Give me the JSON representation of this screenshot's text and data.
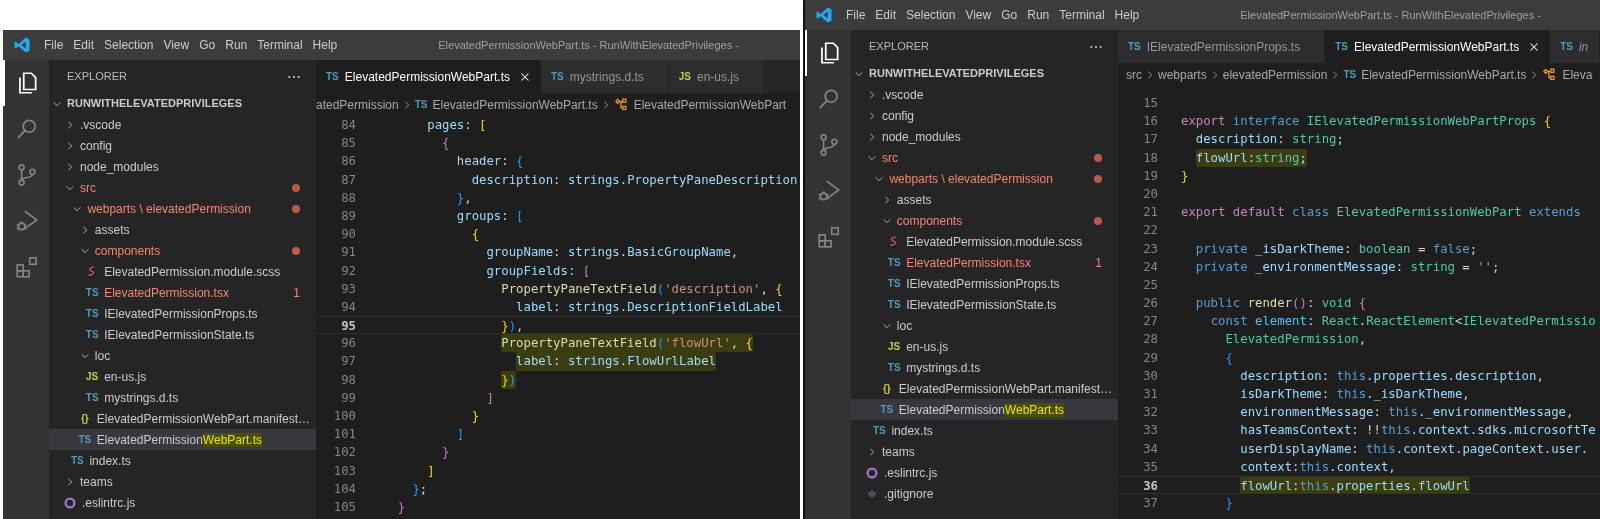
{
  "windows": [
    {
      "title": "ElevatedPermissionWebPart.ts - RunWithElevatedPrivileges -",
      "menu": [
        "File",
        "Edit",
        "Selection",
        "View",
        "Go",
        "Run",
        "Terminal",
        "Help"
      ],
      "activity_bar": [
        {
          "kind": "explorer",
          "selected": true
        },
        {
          "kind": "search",
          "selected": false
        },
        {
          "kind": "source-control",
          "selected": false
        },
        {
          "kind": "run-debug",
          "selected": false
        },
        {
          "kind": "extensions",
          "selected": false
        }
      ],
      "explorer": {
        "header": "EXPLORER",
        "tree": [
          {
            "label": "RUNWITHELEVATEDPRIVILEGES",
            "kind": "root",
            "expanded": true,
            "selected": false,
            "modified": false,
            "children": [
              {
                "label": ".vscode",
                "kind": "folder",
                "expanded": false,
                "selected": false,
                "modified": false
              },
              {
                "label": "config",
                "kind": "folder",
                "expanded": false,
                "selected": false,
                "modified": false
              },
              {
                "label": "node_modules",
                "kind": "folder",
                "expanded": false,
                "selected": false,
                "modified": false
              },
              {
                "label": "src",
                "kind": "folder",
                "expanded": true,
                "selected": false,
                "modified": true,
                "children": [
                  {
                    "label": "webparts \\ elevatedPermission",
                    "kind": "folder",
                    "expanded": true,
                    "selected": false,
                    "modified": true,
                    "children": [
                      {
                        "label": "assets",
                        "kind": "folder",
                        "expanded": false,
                        "selected": false,
                        "modified": false
                      },
                      {
                        "label": "components",
                        "kind": "folder",
                        "expanded": true,
                        "selected": false,
                        "modified": true,
                        "children": [
                          {
                            "label": "ElevatedPermission.module.scss",
                            "kind": "scss",
                            "selected": false,
                            "modified": false
                          },
                          {
                            "label": "ElevatedPermission.tsx",
                            "kind": "ts",
                            "icon": "TS",
                            "selected": false,
                            "modified": true,
                            "badge": "1"
                          },
                          {
                            "label": "IElevatedPermissionProps.ts",
                            "kind": "ts",
                            "icon": "TS",
                            "selected": false,
                            "modified": false
                          },
                          {
                            "label": "IElevatedPermissionState.ts",
                            "kind": "ts",
                            "icon": "TS",
                            "selected": false,
                            "modified": false
                          }
                        ]
                      },
                      {
                        "label": "loc",
                        "kind": "folder",
                        "expanded": true,
                        "selected": false,
                        "modified": false,
                        "children": [
                          {
                            "label": "en-us.js",
                            "kind": "js",
                            "icon": "JS",
                            "selected": false,
                            "modified": false
                          },
                          {
                            "label": "mystrings.d.ts",
                            "kind": "ts",
                            "icon": "TS",
                            "selected": false,
                            "modified": false
                          }
                        ]
                      },
                      {
                        "label": "ElevatedPermissionWebPart.manifest…",
                        "kind": "json",
                        "icon": "{}",
                        "selected": false,
                        "modified": false
                      },
                      {
                        "label_parts": [
                          {
                            "text": "ElevatedPermission",
                            "highlighted": false
                          },
                          {
                            "text": "WebPart.ts",
                            "highlighted": true
                          }
                        ],
                        "kind": "ts",
                        "icon": "TS",
                        "selected": true,
                        "modified": false
                      }
                    ]
                  },
                  {
                    "label": "index.ts",
                    "kind": "ts",
                    "icon": "TS",
                    "selected": false,
                    "modified": false
                  }
                ]
              },
              {
                "label": "teams",
                "kind": "folder",
                "expanded": false,
                "selected": false,
                "modified": false
              },
              {
                "label": ".eslintrc.js",
                "kind": "eslint",
                "selected": false,
                "modified": false
              }
            ]
          }
        ]
      },
      "tabs": [
        {
          "kind": "ts",
          "icon": "TS",
          "label": "ElevatedPermissionWebPart.ts",
          "selected": true,
          "preview": false
        },
        {
          "kind": "ts",
          "icon": "TS",
          "label": "mystrings.d.ts",
          "selected": false,
          "preview": false
        },
        {
          "kind": "js",
          "icon": "JS",
          "label": "en-us.js",
          "selected": false,
          "preview": false
        }
      ],
      "breadcrumb": [
        {
          "label": "atedPermission",
          "kind": "folder"
        },
        {
          "label": "ElevatedPermissionWebPart.ts",
          "kind": "file",
          "icon": "TS"
        },
        {
          "label": "ElevatedPermissionWebPart",
          "kind": "class"
        }
      ],
      "code": {
        "lines": [
          {
            "number": "84",
            "current": false,
            "highlighted": false,
            "tokens": [
              {
                "text": "        pages",
                "kind": "variable"
              },
              {
                "text": ": ",
                "kind": "punctuation"
              },
              {
                "text": "[",
                "kind": "bracket-1"
              }
            ]
          },
          {
            "number": "85",
            "current": false,
            "highlighted": false,
            "tokens": [
              {
                "text": "          {",
                "kind": "bracket-2"
              }
            ]
          },
          {
            "number": "86",
            "current": false,
            "highlighted": false,
            "tokens": [
              {
                "text": "            header",
                "kind": "variable"
              },
              {
                "text": ": ",
                "kind": "punctuation"
              },
              {
                "text": "{",
                "kind": "bracket-3"
              }
            ]
          },
          {
            "number": "87",
            "current": false,
            "highlighted": false,
            "tokens": [
              {
                "text": "              description",
                "kind": "variable"
              },
              {
                "text": ": ",
                "kind": "punctuation"
              },
              {
                "text": "strings",
                "kind": "variable"
              },
              {
                "text": ".",
                "kind": "punctuation"
              },
              {
                "text": "PropertyPaneDescription",
                "kind": "variable"
              }
            ]
          },
          {
            "number": "88",
            "current": false,
            "highlighted": false,
            "tokens": [
              {
                "text": "            }",
                "kind": "bracket-3"
              },
              {
                "text": ",",
                "kind": "punctuation"
              }
            ]
          },
          {
            "number": "89",
            "current": false,
            "highlighted": false,
            "tokens": [
              {
                "text": "            groups",
                "kind": "variable"
              },
              {
                "text": ": ",
                "kind": "punctuation"
              },
              {
                "text": "[",
                "kind": "bracket-3"
              }
            ]
          },
          {
            "number": "90",
            "current": false,
            "highlighted": false,
            "tokens": [
              {
                "text": "              {",
                "kind": "bracket-1"
              }
            ]
          },
          {
            "number": "91",
            "current": false,
            "highlighted": false,
            "tokens": [
              {
                "text": "                groupName",
                "kind": "variable"
              },
              {
                "text": ": ",
                "kind": "punctuation"
              },
              {
                "text": "strings",
                "kind": "variable"
              },
              {
                "text": ".",
                "kind": "punctuation"
              },
              {
                "text": "BasicGroupName",
                "kind": "variable"
              },
              {
                "text": ",",
                "kind": "punctuation"
              }
            ]
          },
          {
            "number": "92",
            "current": false,
            "highlighted": false,
            "tokens": [
              {
                "text": "                groupFields",
                "kind": "variable"
              },
              {
                "text": ": ",
                "kind": "punctuation"
              },
              {
                "text": "[",
                "kind": "bracket-2"
              }
            ]
          },
          {
            "number": "93",
            "current": false,
            "highlighted": false,
            "tokens": [
              {
                "text": "                  PropertyPaneTextField",
                "kind": "function"
              },
              {
                "text": "(",
                "kind": "bracket-3"
              },
              {
                "text": "'description'",
                "kind": "string"
              },
              {
                "text": ", ",
                "kind": "punctuation"
              },
              {
                "text": "{",
                "kind": "bracket-1"
              }
            ]
          },
          {
            "number": "94",
            "current": false,
            "highlighted": false,
            "tokens": [
              {
                "text": "                    label",
                "kind": "variable"
              },
              {
                "text": ": ",
                "kind": "punctuation"
              },
              {
                "text": "strings",
                "kind": "variable"
              },
              {
                "text": ".",
                "kind": "punctuation"
              },
              {
                "text": "DescriptionFieldLabel",
                "kind": "variable"
              }
            ]
          },
          {
            "number": "95",
            "current": true,
            "highlighted": false,
            "tokens": [
              {
                "text": "                  }",
                "kind": "bracket-1"
              },
              {
                "text": ")",
                "kind": "bracket-3"
              },
              {
                "text": ",",
                "kind": "punctuation"
              }
            ]
          },
          {
            "number": "96",
            "current": false,
            "highlighted": true,
            "tokens": [
              {
                "text": "                  PropertyPaneTextField",
                "kind": "function"
              },
              {
                "text": "(",
                "kind": "bracket-3"
              },
              {
                "text": "'flowUrl'",
                "kind": "string"
              },
              {
                "text": ", ",
                "kind": "punctuation"
              },
              {
                "text": "{",
                "kind": "bracket-1"
              }
            ]
          },
          {
            "number": "97",
            "current": false,
            "highlighted": true,
            "tokens": [
              {
                "text": "                    label",
                "kind": "variable"
              },
              {
                "text": ": ",
                "kind": "punctuation"
              },
              {
                "text": "strings",
                "kind": "variable"
              },
              {
                "text": ".",
                "kind": "punctuation"
              },
              {
                "text": "FlowUrlLabel",
                "kind": "variable"
              }
            ]
          },
          {
            "number": "98",
            "current": false,
            "highlighted": true,
            "tokens": [
              {
                "text": "                  }",
                "kind": "bracket-1"
              },
              {
                "text": ")",
                "kind": "bracket-3"
              }
            ]
          },
          {
            "number": "99",
            "current": false,
            "highlighted": false,
            "tokens": [
              {
                "text": "                ]",
                "kind": "bracket-2"
              }
            ]
          },
          {
            "number": "100",
            "current": false,
            "highlighted": false,
            "tokens": [
              {
                "text": "              }",
                "kind": "bracket-1"
              }
            ]
          },
          {
            "number": "101",
            "current": false,
            "highlighted": false,
            "tokens": [
              {
                "text": "            ]",
                "kind": "bracket-3"
              }
            ]
          },
          {
            "number": "102",
            "current": false,
            "highlighted": false,
            "tokens": [
              {
                "text": "          }",
                "kind": "bracket-2"
              }
            ]
          },
          {
            "number": "103",
            "current": false,
            "highlighted": false,
            "tokens": [
              {
                "text": "        ]",
                "kind": "bracket-1"
              }
            ]
          },
          {
            "number": "104",
            "current": false,
            "highlighted": false,
            "tokens": [
              {
                "text": "      }",
                "kind": "bracket-3"
              },
              {
                "text": ";",
                "kind": "punctuation"
              }
            ]
          },
          {
            "number": "105",
            "current": false,
            "highlighted": false,
            "tokens": [
              {
                "text": "    }",
                "kind": "bracket-2"
              }
            ]
          }
        ]
      }
    },
    {
      "title": "ElevatedPermissionWebPart.ts - RunWithElevatedPrivileges -",
      "menu": [
        "File",
        "Edit",
        "Selection",
        "View",
        "Go",
        "Run",
        "Terminal",
        "Help"
      ],
      "activity_bar": [
        {
          "kind": "explorer",
          "selected": true
        },
        {
          "kind": "search",
          "selected": false
        },
        {
          "kind": "source-control",
          "selected": false
        },
        {
          "kind": "run-debug",
          "selected": false
        },
        {
          "kind": "extensions",
          "selected": false
        }
      ],
      "explorer": {
        "header": "EXPLORER",
        "tree": [
          {
            "label": "RUNWITHELEVATEDPRIVILEGES",
            "kind": "root",
            "expanded": true,
            "selected": false,
            "modified": false,
            "children": [
              {
                "label": ".vscode",
                "kind": "folder",
                "expanded": false,
                "selected": false,
                "modified": false
              },
              {
                "label": "config",
                "kind": "folder",
                "expanded": false,
                "selected": false,
                "modified": false
              },
              {
                "label": "node_modules",
                "kind": "folder",
                "expanded": false,
                "selected": false,
                "modified": false
              },
              {
                "label": "src",
                "kind": "folder",
                "expanded": true,
                "selected": false,
                "modified": true,
                "children": [
                  {
                    "label": "webparts \\ elevatedPermission",
                    "kind": "folder",
                    "expanded": true,
                    "selected": false,
                    "modified": true,
                    "children": [
                      {
                        "label": "assets",
                        "kind": "folder",
                        "expanded": false,
                        "selected": false,
                        "modified": false
                      },
                      {
                        "label": "components",
                        "kind": "folder",
                        "expanded": true,
                        "selected": false,
                        "modified": true,
                        "children": [
                          {
                            "label": "ElevatedPermission.module.scss",
                            "kind": "scss",
                            "selected": false,
                            "modified": false
                          },
                          {
                            "label": "ElevatedPermission.tsx",
                            "kind": "ts",
                            "icon": "TS",
                            "selected": false,
                            "modified": true,
                            "badge": "1"
                          },
                          {
                            "label": "IElevatedPermissionProps.ts",
                            "kind": "ts",
                            "icon": "TS",
                            "selected": false,
                            "modified": false
                          },
                          {
                            "label": "IElevatedPermissionState.ts",
                            "kind": "ts",
                            "icon": "TS",
                            "selected": false,
                            "modified": false
                          }
                        ]
                      },
                      {
                        "label": "loc",
                        "kind": "folder",
                        "expanded": true,
                        "selected": false,
                        "modified": false,
                        "children": [
                          {
                            "label": "en-us.js",
                            "kind": "js",
                            "icon": "JS",
                            "selected": false,
                            "modified": false
                          },
                          {
                            "label": "mystrings.d.ts",
                            "kind": "ts",
                            "icon": "TS",
                            "selected": false,
                            "modified": false
                          }
                        ]
                      },
                      {
                        "label": "ElevatedPermissionWebPart.manifest…",
                        "kind": "json",
                        "icon": "{}",
                        "selected": false,
                        "modified": false
                      },
                      {
                        "label_parts": [
                          {
                            "text": "ElevatedPermission",
                            "highlighted": false
                          },
                          {
                            "text": "WebPart.ts",
                            "highlighted": true
                          }
                        ],
                        "kind": "ts",
                        "icon": "TS",
                        "selected": true,
                        "modified": false
                      }
                    ]
                  },
                  {
                    "label": "index.ts",
                    "kind": "ts",
                    "icon": "TS",
                    "selected": false,
                    "modified": false
                  }
                ]
              },
              {
                "label": "teams",
                "kind": "folder",
                "expanded": false,
                "selected": false,
                "modified": false
              },
              {
                "label": ".eslintrc.js",
                "kind": "eslint",
                "selected": false,
                "modified": false
              },
              {
                "label": ".gitignore",
                "kind": "git",
                "selected": false,
                "modified": false
              }
            ]
          }
        ]
      },
      "tabs": [
        {
          "kind": "ts",
          "icon": "TS",
          "label": "IElevatedPermissionProps.ts",
          "selected": false,
          "preview": false
        },
        {
          "kind": "ts",
          "icon": "TS",
          "label": "ElevatedPermissionWebPart.ts",
          "selected": true,
          "preview": false
        },
        {
          "kind": "ts",
          "icon": "TS",
          "label": "in",
          "selected": false,
          "preview": true
        }
      ],
      "breadcrumb": [
        {
          "label": "src",
          "kind": "folder"
        },
        {
          "label": "webparts",
          "kind": "folder"
        },
        {
          "label": "elevatedPermission",
          "kind": "folder"
        },
        {
          "label": "ElevatedPermissionWebPart.ts",
          "kind": "file",
          "icon": "TS"
        },
        {
          "label": "Eleva",
          "kind": "class"
        }
      ],
      "code": {
        "lines": [
          {
            "number": "15",
            "current": false
          },
          {
            "number": "16",
            "current": false,
            "highlighted": false,
            "tokens": [
              {
                "text": "export",
                "kind": "keyword-control"
              },
              {
                "text": " interface",
                "kind": "keyword"
              },
              {
                "text": " IElevatedPermissionWebPartProps",
                "kind": "type"
              },
              {
                "text": " {",
                "kind": "bracket-1"
              }
            ]
          },
          {
            "number": "17",
            "current": false,
            "highlighted": false,
            "tokens": [
              {
                "text": "  description",
                "kind": "variable"
              },
              {
                "text": ": ",
                "kind": "punctuation"
              },
              {
                "text": "string",
                "kind": "type"
              },
              {
                "text": ";",
                "kind": "punctuation"
              }
            ]
          },
          {
            "number": "18",
            "current": false,
            "highlighted": true,
            "tokens": [
              {
                "text": "  flowUrl",
                "kind": "variable"
              },
              {
                "text": ":",
                "kind": "punctuation"
              },
              {
                "text": "string",
                "kind": "type"
              },
              {
                "text": ";",
                "kind": "punctuation"
              }
            ]
          },
          {
            "number": "19",
            "current": false,
            "highlighted": false,
            "tokens": [
              {
                "text": "}",
                "kind": "bracket-1"
              }
            ]
          },
          {
            "number": "20",
            "current": false
          },
          {
            "number": "21",
            "current": false,
            "highlighted": false,
            "tokens": [
              {
                "text": "export default",
                "kind": "keyword-control"
              },
              {
                "text": " class",
                "kind": "keyword"
              },
              {
                "text": " ElevatedPermissionWebPart",
                "kind": "type"
              },
              {
                "text": " extends",
                "kind": "keyword"
              }
            ]
          },
          {
            "number": "22",
            "current": false
          },
          {
            "number": "23",
            "current": false,
            "highlighted": false,
            "tokens": [
              {
                "text": "  private",
                "kind": "keyword"
              },
              {
                "text": " _isDarkTheme",
                "kind": "variable"
              },
              {
                "text": ": ",
                "kind": "punctuation"
              },
              {
                "text": "boolean",
                "kind": "type"
              },
              {
                "text": " = ",
                "kind": "punctuation"
              },
              {
                "text": "false",
                "kind": "keyword"
              },
              {
                "text": ";",
                "kind": "punctuation"
              }
            ]
          },
          {
            "number": "24",
            "current": false,
            "highlighted": false,
            "tokens": [
              {
                "text": "  private",
                "kind": "keyword"
              },
              {
                "text": " _environmentMessage",
                "kind": "variable"
              },
              {
                "text": ": ",
                "kind": "punctuation"
              },
              {
                "text": "string",
                "kind": "type"
              },
              {
                "text": " = ",
                "kind": "punctuation"
              },
              {
                "text": "''",
                "kind": "string"
              },
              {
                "text": ";",
                "kind": "punctuation"
              }
            ]
          },
          {
            "number": "25",
            "current": false
          },
          {
            "number": "26",
            "current": false,
            "highlighted": false,
            "tokens": [
              {
                "text": "  public",
                "kind": "keyword"
              },
              {
                "text": " render",
                "kind": "function"
              },
              {
                "text": "()",
                "kind": "bracket-2"
              },
              {
                "text": ": ",
                "kind": "punctuation"
              },
              {
                "text": "void",
                "kind": "type"
              },
              {
                "text": " {",
                "kind": "bracket-2"
              }
            ]
          },
          {
            "number": "27",
            "current": false,
            "highlighted": false,
            "tokens": [
              {
                "text": "    const",
                "kind": "keyword"
              },
              {
                "text": " element",
                "kind": "constant"
              },
              {
                "text": ": ",
                "kind": "punctuation"
              },
              {
                "text": "React",
                "kind": "type"
              },
              {
                "text": ".",
                "kind": "punctuation"
              },
              {
                "text": "ReactElement",
                "kind": "type"
              },
              {
                "text": "<",
                "kind": "punctuation"
              },
              {
                "text": "IElevatedPermissio",
                "kind": "type"
              }
            ]
          },
          {
            "number": "28",
            "current": false,
            "highlighted": false,
            "tokens": [
              {
                "text": "      ElevatedPermission",
                "kind": "type"
              },
              {
                "text": ",",
                "kind": "punctuation"
              }
            ]
          },
          {
            "number": "29",
            "current": false,
            "highlighted": false,
            "tokens": [
              {
                "text": "      {",
                "kind": "bracket-3"
              }
            ]
          },
          {
            "number": "30",
            "current": false,
            "highlighted": false,
            "tokens": [
              {
                "text": "        description",
                "kind": "variable"
              },
              {
                "text": ": ",
                "kind": "punctuation"
              },
              {
                "text": "this",
                "kind": "keyword"
              },
              {
                "text": ".",
                "kind": "punctuation"
              },
              {
                "text": "properties",
                "kind": "variable"
              },
              {
                "text": ".",
                "kind": "punctuation"
              },
              {
                "text": "description",
                "kind": "variable"
              },
              {
                "text": ",",
                "kind": "punctuation"
              }
            ]
          },
          {
            "number": "31",
            "current": false,
            "highlighted": false,
            "tokens": [
              {
                "text": "        isDarkTheme",
                "kind": "variable"
              },
              {
                "text": ": ",
                "kind": "punctuation"
              },
              {
                "text": "this",
                "kind": "keyword"
              },
              {
                "text": ".",
                "kind": "punctuation"
              },
              {
                "text": "_isDarkTheme",
                "kind": "variable"
              },
              {
                "text": ",",
                "kind": "punctuation"
              }
            ]
          },
          {
            "number": "32",
            "current": false,
            "highlighted": false,
            "tokens": [
              {
                "text": "        environmentMessage",
                "kind": "variable"
              },
              {
                "text": ": ",
                "kind": "punctuation"
              },
              {
                "text": "this",
                "kind": "keyword"
              },
              {
                "text": ".",
                "kind": "punctuation"
              },
              {
                "text": "_environmentMessage",
                "kind": "variable"
              },
              {
                "text": ",",
                "kind": "punctuation"
              }
            ]
          },
          {
            "number": "33",
            "current": false,
            "highlighted": false,
            "tokens": [
              {
                "text": "        hasTeamsContext",
                "kind": "variable"
              },
              {
                "text": ": !!",
                "kind": "punctuation"
              },
              {
                "text": "this",
                "kind": "keyword"
              },
              {
                "text": ".",
                "kind": "punctuation"
              },
              {
                "text": "context",
                "kind": "variable"
              },
              {
                "text": ".",
                "kind": "punctuation"
              },
              {
                "text": "sdks",
                "kind": "variable"
              },
              {
                "text": ".",
                "kind": "punctuation"
              },
              {
                "text": "microsoftTe",
                "kind": "variable"
              }
            ]
          },
          {
            "number": "34",
            "current": false,
            "highlighted": false,
            "tokens": [
              {
                "text": "        userDisplayName",
                "kind": "variable"
              },
              {
                "text": ": ",
                "kind": "punctuation"
              },
              {
                "text": "this",
                "kind": "keyword"
              },
              {
                "text": ".",
                "kind": "punctuation"
              },
              {
                "text": "context",
                "kind": "variable"
              },
              {
                "text": ".",
                "kind": "punctuation"
              },
              {
                "text": "pageContext",
                "kind": "variable"
              },
              {
                "text": ".",
                "kind": "punctuation"
              },
              {
                "text": "user",
                "kind": "variable"
              },
              {
                "text": ".",
                "kind": "punctuation"
              }
            ]
          },
          {
            "number": "35",
            "current": false,
            "highlighted": false,
            "tokens": [
              {
                "text": "        context",
                "kind": "variable"
              },
              {
                "text": ":",
                "kind": "punctuation"
              },
              {
                "text": "this",
                "kind": "keyword"
              },
              {
                "text": ".",
                "kind": "punctuation"
              },
              {
                "text": "context",
                "kind": "variable"
              },
              {
                "text": ",",
                "kind": "punctuation"
              }
            ]
          },
          {
            "number": "36",
            "current": true,
            "highlighted": true,
            "tokens": [
              {
                "text": "        flowUrl",
                "kind": "variable"
              },
              {
                "text": ":",
                "kind": "punctuation"
              },
              {
                "text": "this",
                "kind": "keyword"
              },
              {
                "text": ".",
                "kind": "punctuation"
              },
              {
                "text": "properties",
                "kind": "variable"
              },
              {
                "text": ".",
                "kind": "punctuation"
              },
              {
                "text": "flowUrl",
                "kind": "variable"
              }
            ]
          },
          {
            "number": "37",
            "current": false,
            "highlighted": false,
            "tokens": [
              {
                "text": "      }",
                "kind": "bracket-3"
              }
            ]
          }
        ]
      }
    }
  ]
}
